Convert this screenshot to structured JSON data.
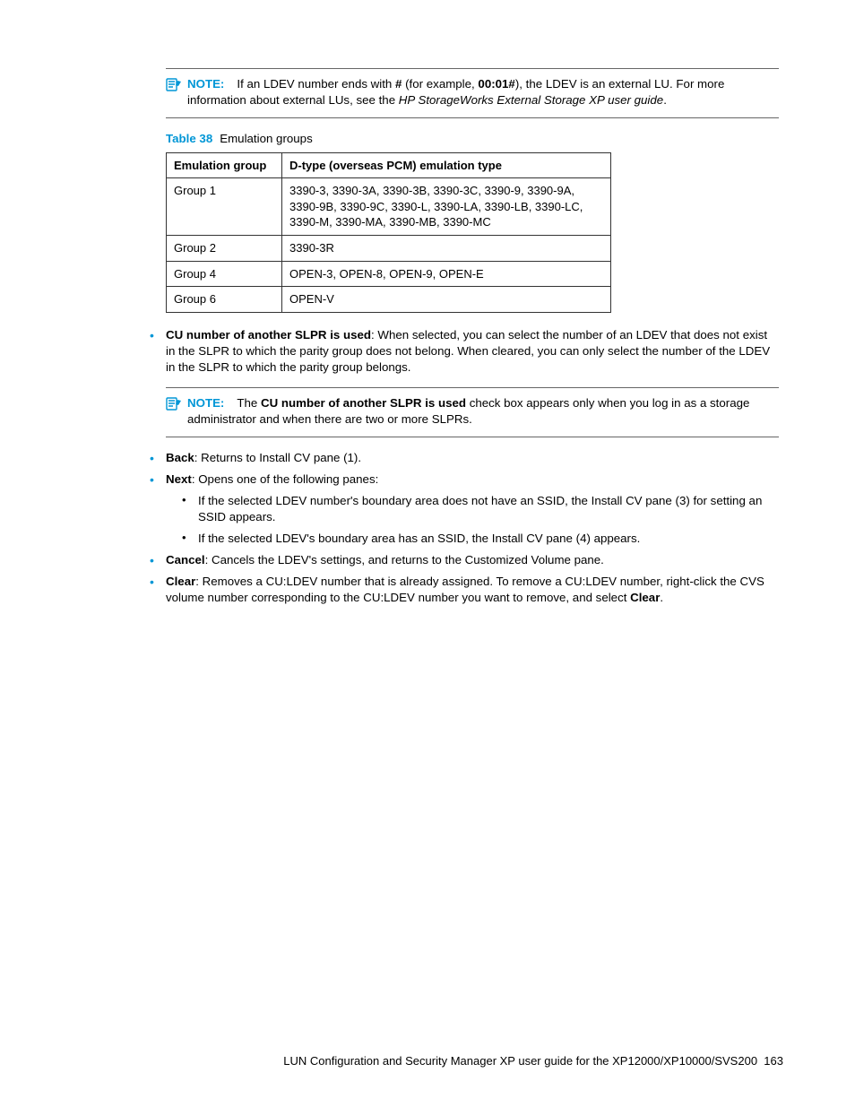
{
  "note1": {
    "label": "NOTE:",
    "part1": "If an LDEV number ends with ",
    "hash": "#",
    "part2": " (for example, ",
    "example": "00:01#",
    "part3": "), the LDEV is an external LU. For more information about external LUs, see the ",
    "italic": "HP StorageWorks External Storage XP user guide",
    "part4": "."
  },
  "tableCaption": {
    "num": "Table 38",
    "title": "Emulation groups"
  },
  "table": {
    "h1": "Emulation group",
    "h2": "D-type (overseas PCM) emulation type",
    "rows": [
      {
        "c1": "Group 1",
        "c2": "3390-3, 3390-3A, 3390-3B, 3390-3C, 3390-9, 3390-9A, 3390-9B, 3390-9C, 3390-L, 3390-LA, 3390-LB, 3390-LC, 3390-M, 3390-MA, 3390-MB, 3390-MC"
      },
      {
        "c1": "Group 2",
        "c2": "3390-3R"
      },
      {
        "c1": "Group 4",
        "c2": "OPEN-3, OPEN-8, OPEN-9, OPEN-E"
      },
      {
        "c1": "Group 6",
        "c2": "OPEN-V"
      }
    ]
  },
  "bullet_cu": {
    "label": "CU number of another SLPR is used",
    "text": ": When selected, you can select the number of an LDEV that does not exist in the SLPR to which the parity group does not belong. When cleared, you can only select the number of the LDEV in the SLPR to which the parity group belongs."
  },
  "note2": {
    "label": "NOTE:",
    "pre": "The ",
    "bold": "CU number of another SLPR is used",
    "post": " check box appears only when you log in as a storage administrator and when there are two or more SLPRs."
  },
  "bullet_back": {
    "label": "Back",
    "text": ": Returns to Install CV pane (1)."
  },
  "bullet_next": {
    "label": "Next",
    "text": ": Opens one of the following panes:"
  },
  "sub1": "If the selected LDEV number's boundary area does not have an SSID, the Install CV pane (3) for setting an SSID appears.",
  "sub2": "If the selected LDEV's boundary area has an SSID, the Install CV pane (4) appears.",
  "bullet_cancel": {
    "label": "Cancel",
    "text": ": Cancels the LDEV's settings, and returns to the Customized Volume pane."
  },
  "bullet_clear": {
    "label": "Clear",
    "text": ": Removes a CU:LDEV number that is already assigned. To remove a CU:LDEV number, right-click the CVS volume number corresponding to the CU:LDEV number you want to remove, and select ",
    "trail": "Clear",
    "dot": "."
  },
  "footer": {
    "title": "LUN Configuration and Security Manager XP user guide for the XP12000/XP10000/SVS200",
    "page": "163"
  }
}
